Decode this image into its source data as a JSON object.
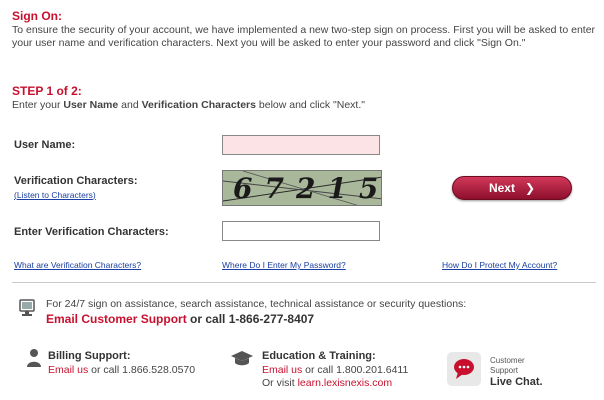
{
  "signon": {
    "title": "Sign On:",
    "intro": "To ensure the security of your account, we have implemented a new two-step sign on process.  First you will be asked to enter your user name and verification characters.  Next you will be asked to enter your password and click \"Sign On.\""
  },
  "step": {
    "title": "STEP 1 of 2:",
    "desc_pre": "Enter your ",
    "desc_username": "User Name",
    "desc_and": " and ",
    "desc_verif": "Verification Characters",
    "desc_post": " below and click \"Next.\""
  },
  "form": {
    "username_label": "User Name:",
    "username_value": "",
    "verif_label": "Verification Characters:",
    "listen_link": "Listen to Characters",
    "captcha_text": "67215",
    "enter_verif_label": "Enter Verification Characters:",
    "enter_verif_value": "",
    "next_label": "Next",
    "next_chevron": "❯"
  },
  "help_links": {
    "what_are": "What are Verification Characters?",
    "where_enter": "Where Do I Enter My Password?",
    "how_protect": "How Do I Protect My Account?"
  },
  "support": {
    "general_text": "For 24/7 sign on assistance, search assistance, technical assistance or security questions:",
    "email_support": "Email Customer Support",
    "or_call": " or call 1-866-277-8407",
    "billing_title": "Billing Support:",
    "billing_email": "Email us",
    "billing_call": " or call 1.866.528.0570",
    "edu_title": "Education & Training:",
    "edu_email": "Email us",
    "edu_call": " or call 1.800.201.6411",
    "edu_visit": "Or visit ",
    "edu_learn": "learn.lexisnexis.com",
    "chat_line1": "Customer",
    "chat_line2": "Support",
    "chat_line3": "Live Chat."
  },
  "colors": {
    "accent_red": "#c8102e",
    "link_blue": "#1a3ea3"
  }
}
